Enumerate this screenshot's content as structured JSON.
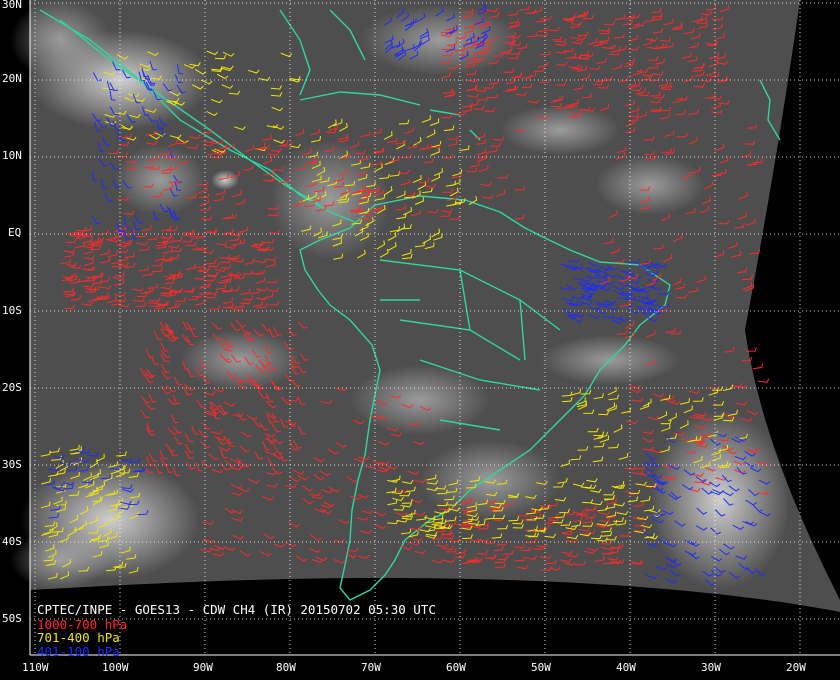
{
  "colors": {
    "low": "#ff2a2a",
    "mid": "#f2e600",
    "high": "#1e2cff",
    "coast": "#2fd6a0",
    "grid": "#ffffff"
  },
  "axes": {
    "lat_labels": [
      "30N",
      "20N",
      "10N",
      "EQ",
      "10S",
      "20S",
      "30S",
      "40S",
      "50S"
    ],
    "lon_labels": [
      "110W",
      "100W",
      "90W",
      "80W",
      "70W",
      "60W",
      "50W",
      "40W",
      "30W",
      "20W"
    ]
  },
  "caption": {
    "title": "CPTEC/INPE - GOES13 - CDW CH4 (IR) 20150702 05:30 UTC",
    "legend": [
      {
        "label": "1000-700 hPa",
        "color": "#ff2a2a"
      },
      {
        "label": "701-400 hPa",
        "color": "#f2e600"
      },
      {
        "label": "401-100 hPa",
        "color": "#1e2cff"
      }
    ]
  }
}
